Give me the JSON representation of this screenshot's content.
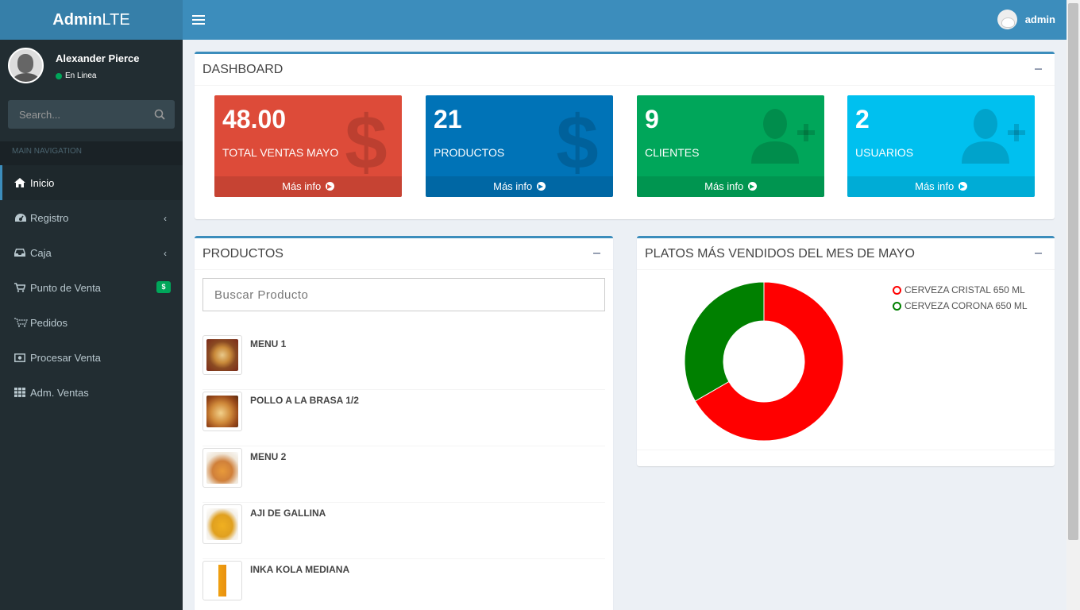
{
  "logo": {
    "bold": "Admin",
    "light": "LTE"
  },
  "header": {
    "username": "admin"
  },
  "sidebar": {
    "user_name": "Alexander Pierce",
    "status": "En Linea",
    "search_placeholder": "Search...",
    "section_header": "MAIN NAVIGATION",
    "items": [
      {
        "label": "Inicio",
        "icon": "home-icon",
        "active": true
      },
      {
        "label": "Registro",
        "icon": "dashboard-icon",
        "chevron": "‹"
      },
      {
        "label": "Caja",
        "icon": "inbox-icon",
        "chevron": "‹"
      },
      {
        "label": "Punto de Venta",
        "icon": "cart-icon",
        "badge": "$"
      },
      {
        "label": "Pedidos",
        "icon": "cart-plus-icon"
      },
      {
        "label": "Procesar Venta",
        "icon": "money-icon"
      },
      {
        "label": "Adm. Ventas",
        "icon": "grid-icon"
      }
    ]
  },
  "dashboard": {
    "title": "DASHBOARD",
    "stats": [
      {
        "value": "48.00",
        "label": "TOTAL VENTAS MAYO",
        "footer": "Más info",
        "color": "#dd4b39",
        "icon": "dollar-icon"
      },
      {
        "value": "21",
        "label": "PRODUCTOS",
        "footer": "Más info",
        "color": "#0073b7",
        "icon": "dollar-icon"
      },
      {
        "value": "9",
        "label": "CLIENTES",
        "footer": "Más info",
        "color": "#00a65a",
        "icon": "user-plus-icon"
      },
      {
        "value": "2",
        "label": "USUARIOS",
        "footer": "Más info",
        "color": "#00c0ef",
        "icon": "user-plus-icon"
      }
    ]
  },
  "productos": {
    "title": "PRODUCTOS",
    "search_placeholder": "Buscar Producto",
    "items": [
      {
        "name": "MENU 1"
      },
      {
        "name": "POLLO A LA BRASA 1/2"
      },
      {
        "name": "MENU 2"
      },
      {
        "name": "AJI DE GALLINA"
      },
      {
        "name": "INKA KOLA MEDIANA"
      }
    ]
  },
  "platos": {
    "title": "PLATOS MÁS VENDIDOS DEL MES DE MAYO"
  },
  "chart_data": {
    "type": "pie",
    "title": "PLATOS MÁS VENDIDOS DEL MES DE MAYO",
    "categories": [
      "CERVEZA CRISTAL 650 ML",
      "CERVEZA CORONA 650 ML"
    ],
    "values": [
      2,
      1
    ],
    "colors": [
      "#ff0000",
      "#008000"
    ],
    "donut": true,
    "legend": "top-right"
  }
}
